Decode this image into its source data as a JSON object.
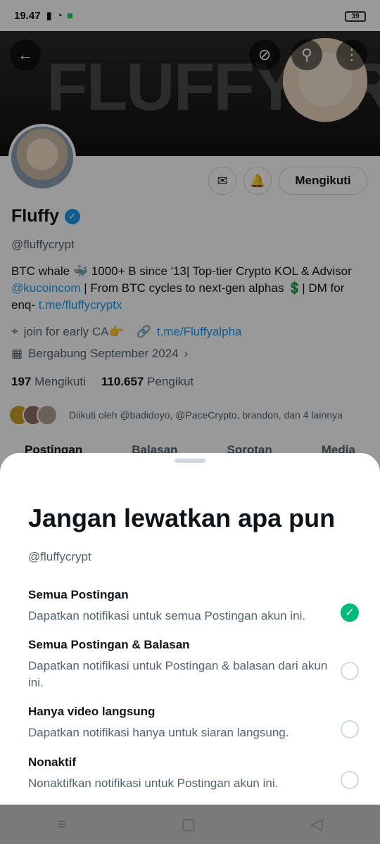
{
  "status_bar": {
    "time": "19.47",
    "battery": "39"
  },
  "banner": {
    "text": "FLUFFYCRYPT"
  },
  "profile": {
    "name": "Fluffy",
    "handle": "@fluffycrypt",
    "follow_label": "Mengikuti",
    "bio_part1": "BTC whale 🐳 1000+ B since '13| Top-tier Crypto KOL & Advisor ",
    "bio_link1": "@kucoincom",
    "bio_part2": " | From BTC cycles to next-gen alphas 💲| DM for enq- ",
    "bio_link2": "t.me/fluffycryptx",
    "location": "join for early CA👉",
    "website": "t.me/Fluffyalpha",
    "joined": "Bergabung September 2024",
    "following_count": "197",
    "following_label": "Mengikuti",
    "followers_count": "110.657",
    "followers_label": "Pengikut",
    "followed_by": "Diikuti oleh @badidoyo, @PaceCrypto, brandon, dan 4 lainnya"
  },
  "tabs": [
    "Postingan",
    "Balasan",
    "Sorotan",
    "Media"
  ],
  "sheet": {
    "title": "Jangan lewatkan apa pun",
    "handle": "@fluffycrypt",
    "options": [
      {
        "title": "Semua Postingan",
        "desc": "Dapatkan notifikasi untuk semua Postingan akun ini.",
        "selected": true
      },
      {
        "title": "Semua Postingan & Balasan",
        "desc": "Dapatkan notifikasi untuk Postingan & balasan dari akun ini.",
        "selected": false
      },
      {
        "title": "Hanya video langsung",
        "desc": "Dapatkan notifikasi hanya untuk siaran langsung.",
        "selected": false
      },
      {
        "title": "Nonaktif",
        "desc": "Nonaktifkan notifikasi untuk Postingan akun ini.",
        "selected": false
      }
    ]
  },
  "colors": {
    "accent": "#1d9bf0",
    "check": "#00ba7c"
  }
}
